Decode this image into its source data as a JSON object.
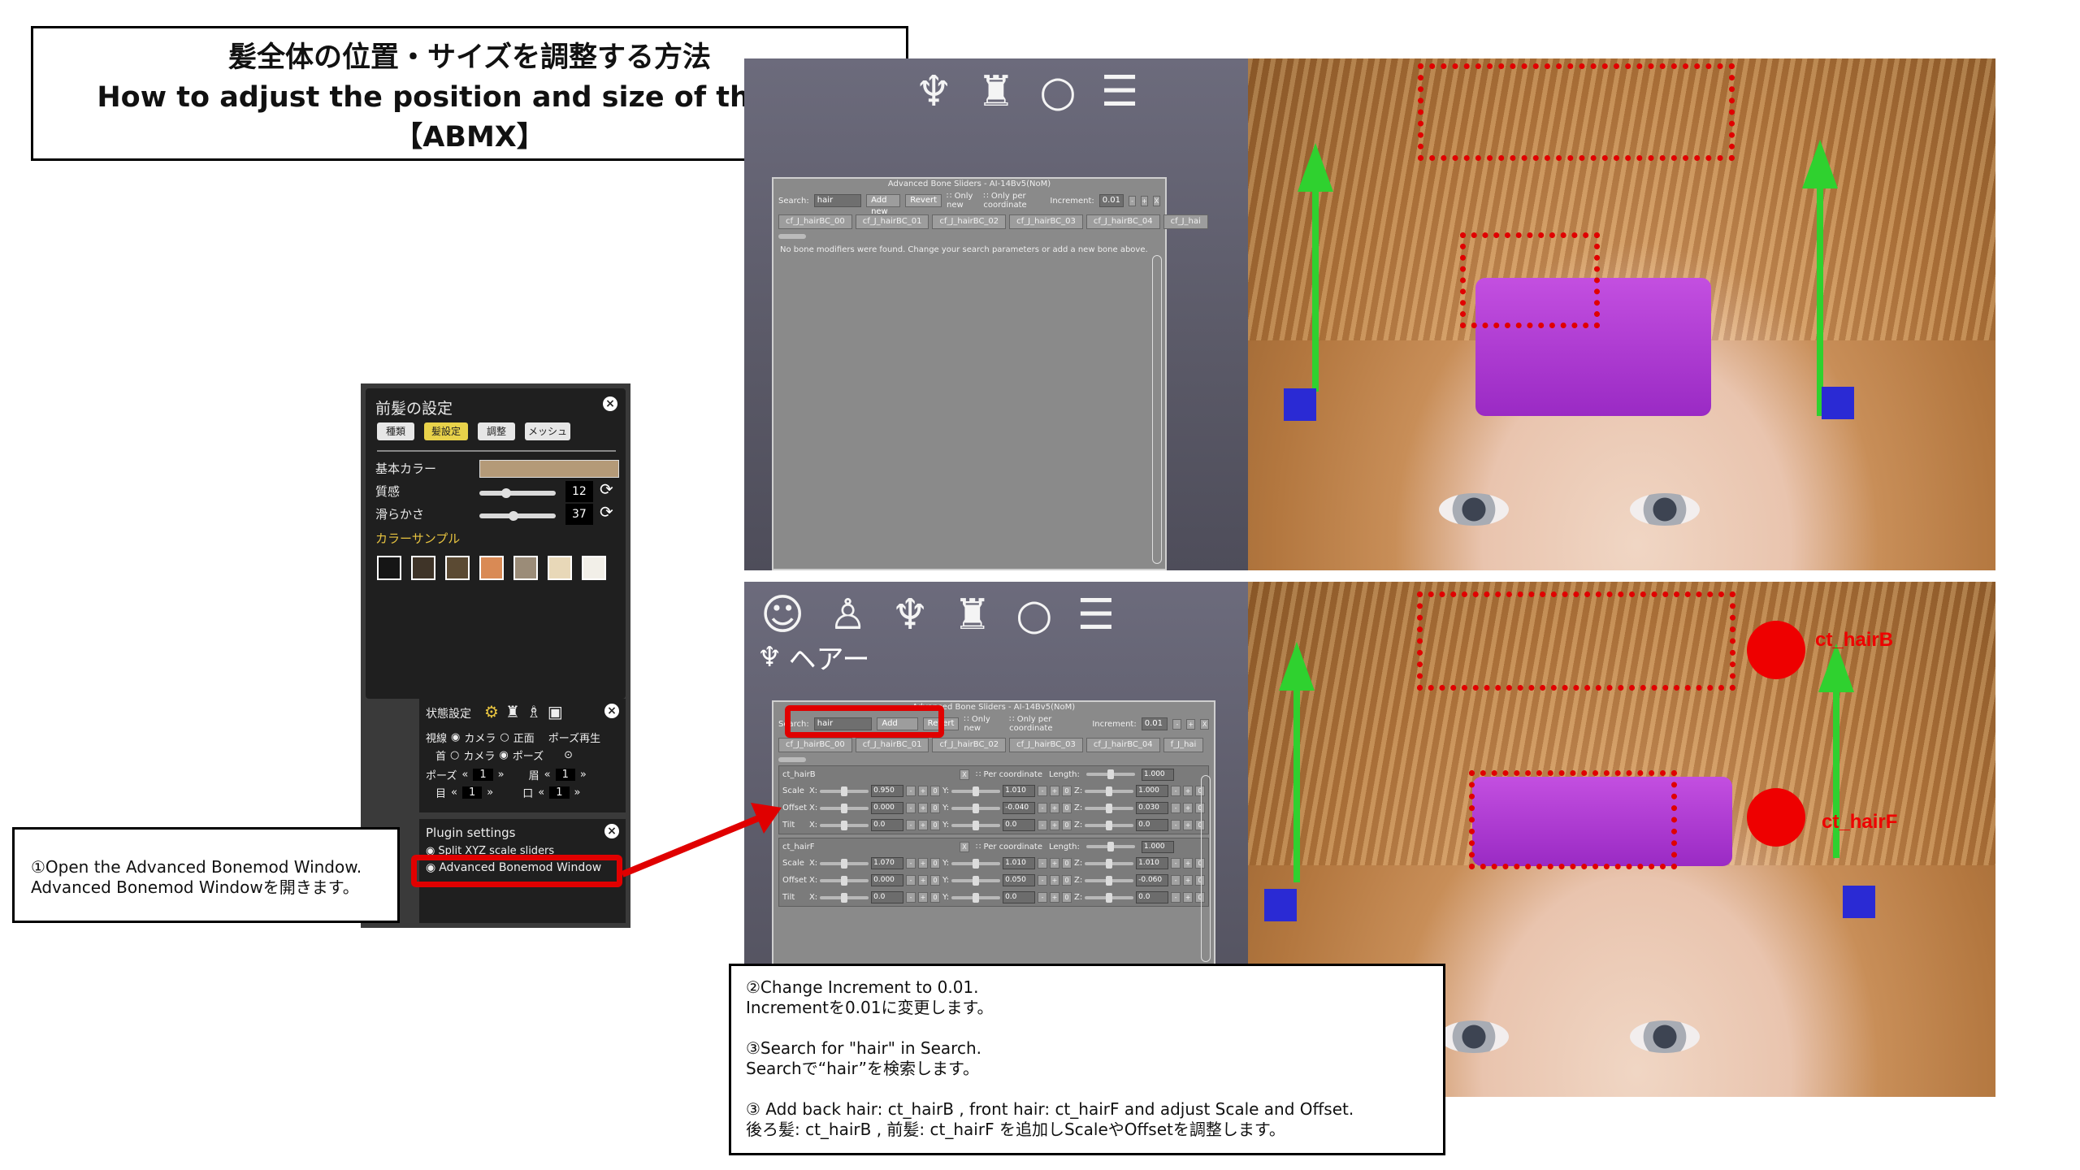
{
  "title": {
    "line1": "髪全体の位置・サイズを調整する方法",
    "line2": "How to adjust the position and size of the hair",
    "line3": "【ABMX】"
  },
  "hair_panel": {
    "title": "前髪の設定",
    "tabs": [
      "種類",
      "髪設定",
      "調整",
      "メッシュ"
    ],
    "active_tab": "髪設定",
    "base_color_label": "基本カラー",
    "base_color": "#b49a78",
    "texture_label": "質感",
    "texture_value": "12",
    "texture_level": 0.35,
    "smooth_label": "滑らかさ",
    "smooth_value": "37",
    "smooth_level": 0.45,
    "color_sample_label": "カラーサンプル",
    "swatches": [
      "#151515",
      "#3f3428",
      "#5b4a33",
      "#d98a55",
      "#9b8c78",
      "#e8d8b8",
      "#f2efe8"
    ]
  },
  "state_panel": {
    "title": "状態設定",
    "gaze_label": "視線",
    "gaze_options": [
      "カメラ",
      "正面"
    ],
    "pose_play": "ポーズ再生",
    "neck_label": "首",
    "neck_options": [
      "カメラ",
      "ポーズ"
    ],
    "pose_label": "ポーズ",
    "pose_value": "1",
    "brow_label": "眉",
    "brow_value": "1",
    "eye_label": "目",
    "eye_value": "1",
    "mouth_label": "口",
    "mouth_value": "1"
  },
  "plugin_panel": {
    "title": "Plugin settings",
    "option1": "Split XYZ scale sliders",
    "option2": "Advanced Bonemod Window"
  },
  "abmx_top": {
    "title": "Advanced Bone Sliders - AI-14Bv5(NoM)",
    "search_label": "Search:",
    "search_value": "hair",
    "add_new": "Add new",
    "revert": "Revert",
    "only_new": "∷ Only new",
    "only_per_coord": "∷ Only per coordinate",
    "increment_label": "Increment:",
    "increment_value": "0.01",
    "tabs": [
      "cf_J_hairBC_00",
      "cf_J_hairBC_01",
      "cf_J_hairBC_02",
      "cf_J_hairBC_03",
      "cf_J_hairBC_04",
      "cf_J_hai"
    ],
    "message": "No bone modifiers were found. Change your search parameters or add a new bone above."
  },
  "abmx_bottom": {
    "title": "Advanced Bone Sliders - AI-14Bv5(NoM)",
    "search_label": "Search:",
    "search_value": "hair",
    "add_new": "Add new",
    "revert": "Revert",
    "only_new": "∷ Only new",
    "only_per_coord": "∷ Only per coordinate",
    "increment_label": "Increment:",
    "increment_value": "0.01",
    "tabs": [
      "cf_J_hairBC_00",
      "cf_J_hairBC_01",
      "cf_J_hairBC_02",
      "cf_J_hairBC_03",
      "cf_J_hairBC_04",
      "f_J_hai"
    ],
    "bones": [
      {
        "name": "ct_hairB",
        "per_coordinate": "∷ Per coordinate",
        "length_label": "Length:",
        "length": "1.000",
        "rows": [
          {
            "label": "Scale",
            "x": "0.950",
            "y": "1.010",
            "z": "1.000"
          },
          {
            "label": "Offset",
            "x": "0.000",
            "y": "-0.040",
            "z": "0.030"
          },
          {
            "label": "Tilt",
            "x": "0.0",
            "y": "0.0",
            "z": "0.0"
          }
        ]
      },
      {
        "name": "ct_hairF",
        "per_coordinate": "∷ Per coordinate",
        "length_label": "Length:",
        "length": "1.000",
        "rows": [
          {
            "label": "Scale",
            "x": "1.070",
            "y": "1.010",
            "z": "1.010"
          },
          {
            "label": "Offset",
            "x": "0.000",
            "y": "0.050",
            "z": "-0.060"
          },
          {
            "label": "Tilt",
            "x": "0.0",
            "y": "0.0",
            "z": "0.0"
          }
        ]
      }
    ]
  },
  "hair_menu_label": "ヘアー",
  "labels": {
    "hairB": "ct_hairB",
    "hairF": "ct_hairF"
  },
  "annotation1": {
    "line1": "①Open the Advanced Bonemod Window.",
    "line2": "Advanced Bonemod Windowを開きます。"
  },
  "annotation2": {
    "l1": "②Change Increment to 0.01.",
    "l2": "Incrementを0.01に変更します。",
    "l3": "③Search for \"hair\" in Search.",
    "l4": "Searchで“hair”を検索します。",
    "l5": "③ Add back hair: ct_hairB , front hair: ct_hairF and adjust Scale and Offset.",
    "l6": "後ろ髪: ct_hairB , 前髪: ct_hairF を追加しScaleやOffsetを調整します。"
  },
  "icons": [
    "smile-icon",
    "body-icon",
    "hair-icon",
    "clothing-icon",
    "accessory-icon",
    "list-icon",
    "settings-gear-icon",
    "shirt-icon",
    "bottle-icon",
    "image-icon",
    "close-icon",
    "refresh-icon",
    "arrow-icon"
  ],
  "colors": {
    "annotation_red": "#e00000",
    "gizmo_green": "#2fd12f",
    "gizmo_blue": "#2a2ad4",
    "headband": "#b23fd6"
  }
}
